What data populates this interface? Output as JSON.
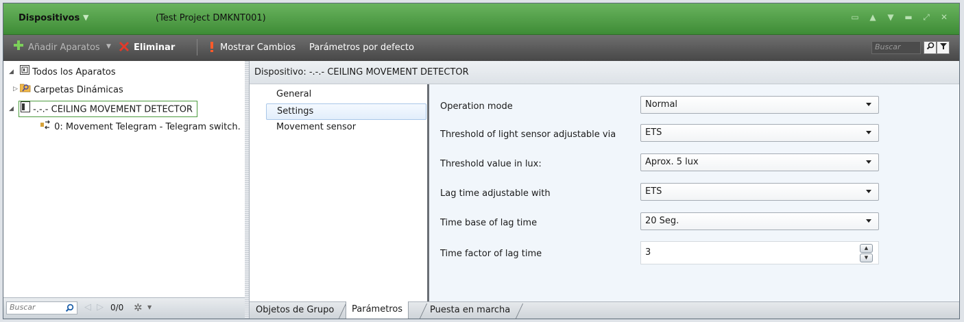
{
  "window": {
    "title": "Dispositivos",
    "title_arrow": "▼",
    "project": "(Test Project DMKNT001)",
    "controls": [
      "▭",
      "▲",
      "▼",
      "▬",
      "⤢",
      "✕"
    ]
  },
  "toolbar": {
    "add_label": "Añadir Aparatos",
    "delete_label": "Eliminar",
    "show_changes_label": "Mostrar Cambios",
    "defaults_label": "Parámetros por defecto",
    "search_placeholder": "Buscar"
  },
  "tree": {
    "items": [
      {
        "label": "Todos los Aparatos",
        "icon": "device-list-icon"
      },
      {
        "label": "Carpetas Dinámicas",
        "icon": "dynamic-folder-icon"
      },
      {
        "label": "-.-.-  CEILING MOVEMENT DETECTOR",
        "icon": "device-icon"
      },
      {
        "label": "0: Movement Telegram - Telegram switch.",
        "icon": "group-object-icon"
      }
    ],
    "search_placeholder": "Buscar",
    "page_counter": "0/0"
  },
  "device": {
    "header": "Dispositivo: -.-.-  CEILING MOVEMENT DETECTOR",
    "nav": [
      "General",
      "Settings",
      "Movement sensor"
    ],
    "selected_nav": "Settings"
  },
  "parameters": [
    {
      "label": "Operation mode",
      "value": "Normal",
      "kind": "select"
    },
    {
      "label": "Threshold of light sensor adjustable via",
      "value": "ETS",
      "kind": "select"
    },
    {
      "label": "Threshold value in lux:",
      "value": "Aprox. 5 lux",
      "kind": "select"
    },
    {
      "label": "Lag time adjustable with",
      "value": "ETS",
      "kind": "select"
    },
    {
      "label": "Time base of lag time",
      "value": "20 Seg.",
      "kind": "select"
    },
    {
      "label": "Time factor of lag time",
      "value": "3",
      "kind": "spinner"
    }
  ],
  "tabs": {
    "group_objects": "Objetos de Grupo",
    "parameters": "Parámetros",
    "commissioning": "Puesta en marcha",
    "active": "Parámetros"
  },
  "colors": {
    "title_green": "#4f9f45",
    "toolbar_gray": "#5a5a5a",
    "selection_blue": "#e2eefb",
    "params_bg": "#f1f6fb"
  }
}
